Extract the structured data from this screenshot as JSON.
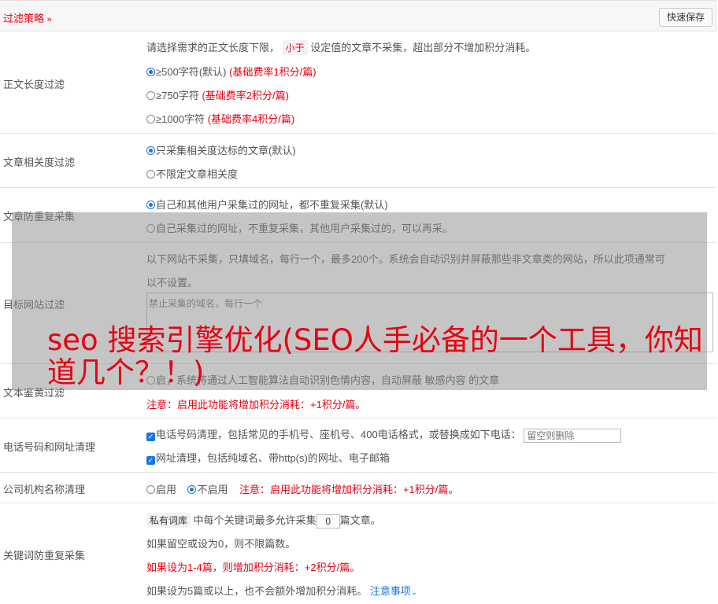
{
  "header": {
    "title": "过滤策略",
    "toggle_icon": "double-chevron-down-icon",
    "save_label": "快速保存"
  },
  "length_filter": {
    "label": "正文长度过滤",
    "desc_prefix": "请选择需求的正文长度下限，",
    "desc_tag": "小于",
    "desc_suffix": "设定值的文章不采集，超出部分不增加积分消耗。",
    "options": [
      {
        "text": "≥500字符(默认)",
        "note": "(基础费率1积分/篇)",
        "selected": true
      },
      {
        "text": "≥750字符",
        "note": "(基础费率2积分/篇)",
        "selected": false
      },
      {
        "text": "≥1000字符",
        "note": "(基础费率4积分/篇)",
        "selected": false
      }
    ]
  },
  "relevance": {
    "label": "文章相关度过滤",
    "options": [
      {
        "text": "只采集相关度达标的文章(默认)",
        "selected": true
      },
      {
        "text": "不限定文章相关度",
        "selected": false
      }
    ]
  },
  "dedup": {
    "label": "文章防重复采集",
    "options": [
      {
        "text": "自己和其他用户采集过的网址，都不重复采集(默认)",
        "selected": true
      },
      {
        "text": "自己采集过的网址，不重复采集，其他用户采集过的，可以再采。",
        "selected": false
      }
    ]
  },
  "site_filter": {
    "label": "目标网站过滤",
    "desc_line1": "以下网站不采集，只填域名，每行一个，最多200个。系统会自动识别并屏蔽那些非文章类的网站，所以此项通常可",
    "desc_line2": "以不设置。",
    "placeholder": "禁止采集的域名，每行一个"
  },
  "porn_filter": {
    "label": "文本鉴黄过滤",
    "line1": "启，系统将通过人工智能算法自动识别色情内容，自动屏蔽 敏感内容 的文章",
    "note": "注意：启用此功能将增加积分消耗：+1积分/篇。"
  },
  "phone_filter": {
    "label": "电话号码和网址清理",
    "phone_text": "电话号码清理，包括常见的手机号、座机号、400电话格式，或替换成如下电话：",
    "phone_placeholder": "留空则删除",
    "url_text": "网址清理，包括纯域名、带http(s)的网址、电子邮箱"
  },
  "company_filter": {
    "label": "公司机构名称清理",
    "enable": "启用",
    "disable": "不启用",
    "note": "注意：启用此功能将增加积分消耗：+1积分/篇。"
  },
  "keyword_dedup": {
    "label": "关键词防重复采集",
    "tag": "私有词库",
    "text1_before": "中每个关键词最多允许采集",
    "count": "0",
    "text1_after": "篇文章。",
    "line2": "如果留空或设为0，则不限篇数。",
    "line3": "如果设为1-4篇，则增加积分消耗：+2积分/篇。",
    "line4": "如果设为5篇或以上，也不会额外增加积分消耗。",
    "link": "注意事项"
  },
  "overlay_headline": "seo 搜索引擎优化(SEO人手必备的一个工具，你知道几个？！)",
  "colors": {
    "accent_red": "#e60012",
    "link_blue": "#1a73e8"
  }
}
